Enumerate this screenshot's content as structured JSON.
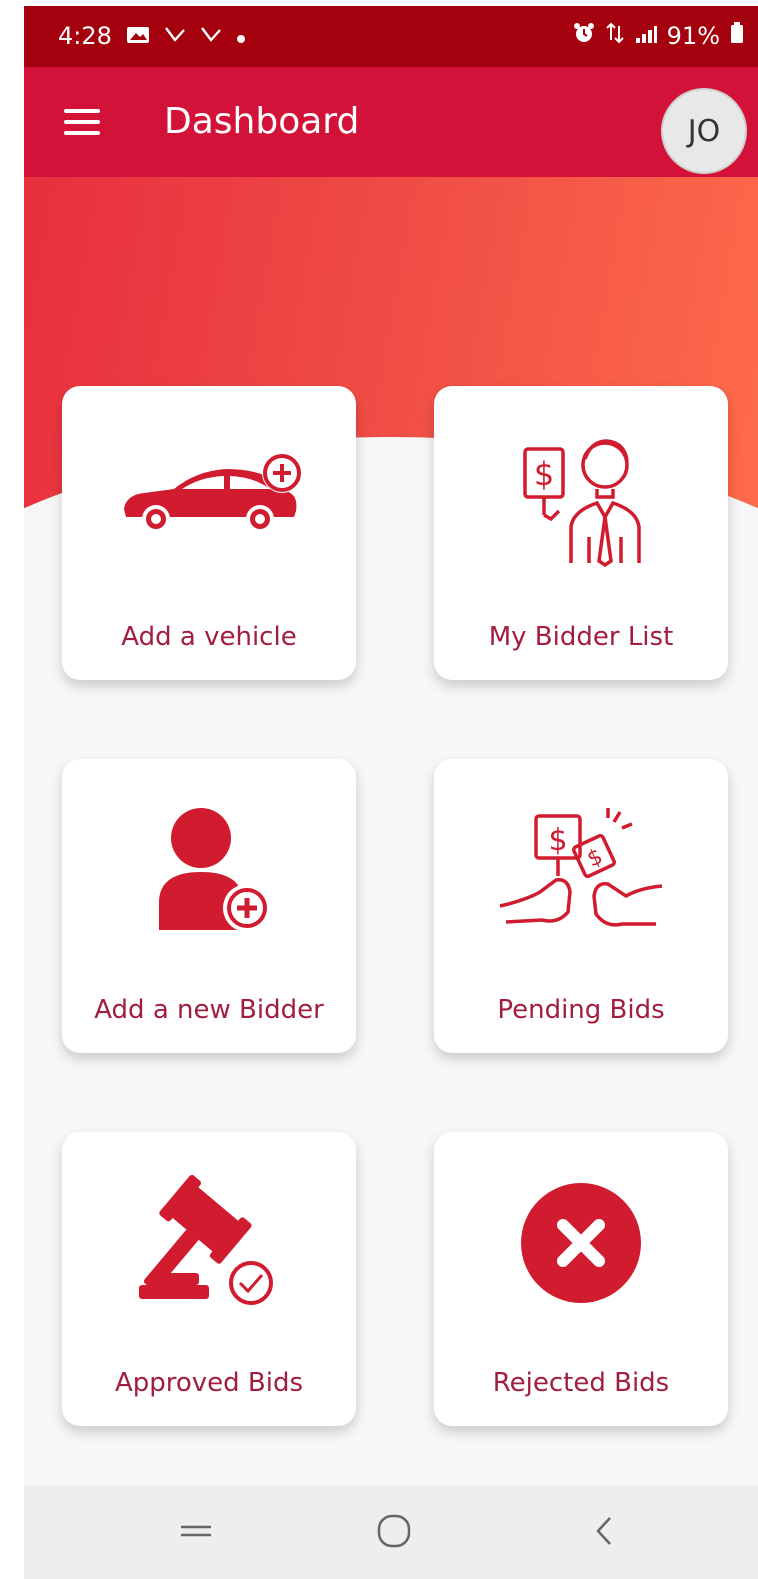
{
  "status_bar": {
    "time": "4:28",
    "battery": "91%"
  },
  "app_bar": {
    "title": "Dashboard",
    "avatar_initials": "JO"
  },
  "colors": {
    "primary": "#d3123a",
    "status_bar": "#a5000d",
    "accent_red": "#d11b2e",
    "label": "#a11e3e"
  },
  "tiles": [
    {
      "label": "Add a vehicle",
      "icon": "car-plus-icon"
    },
    {
      "label": "My Bidder List",
      "icon": "bidder-list-icon"
    },
    {
      "label": "Add a new Bidder",
      "icon": "user-plus-icon"
    },
    {
      "label": "Pending Bids",
      "icon": "pending-bids-icon"
    },
    {
      "label": "Approved Bids",
      "icon": "gavel-check-icon"
    },
    {
      "label": "Rejected Bids",
      "icon": "reject-x-icon"
    }
  ],
  "nav_bar": {
    "items": [
      "recent-apps-icon",
      "home-icon",
      "back-icon"
    ]
  }
}
